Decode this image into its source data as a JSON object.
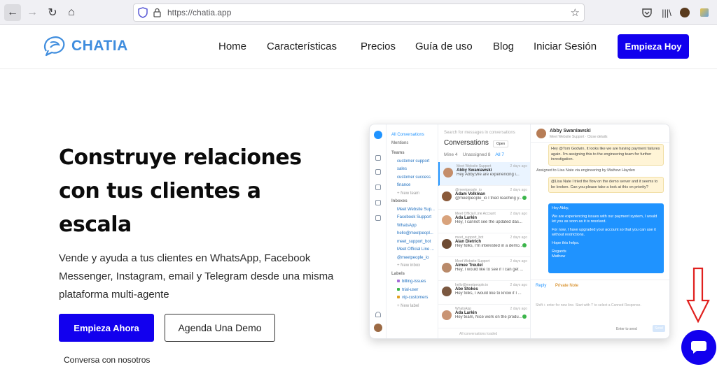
{
  "browser": {
    "url": "https://chatia.app",
    "icons": [
      "back-icon",
      "forward-icon",
      "reload-icon",
      "home-icon",
      "shield-icon",
      "lock-icon",
      "star-icon",
      "pocket-icon",
      "library-icon",
      "account-icon",
      "extension-icon"
    ]
  },
  "nav": {
    "logo_text": "CHATIA",
    "items": [
      "Home",
      "Características",
      "Precios",
      "Guía de uso",
      "Blog",
      "Iniciar Sesión"
    ],
    "cta": "Empieza Hoy"
  },
  "hero": {
    "title_lines": [
      "Construye relaciones",
      "con tus clientes a",
      "escala"
    ],
    "subtitle_lines": [
      "Vende y ayuda a tus clientes en WhatsApp, Facebook",
      "Messenger, Instagram, email y Telegram desde una misma",
      "plataforma multi-agente"
    ],
    "primary_button": "Empieza Ahora",
    "secondary_button": "Agenda Una Demo",
    "talk_link": "Conversa con nosotros"
  },
  "mockup": {
    "sidebar": {
      "all": "All Conversations",
      "mentions": "Mentions",
      "teams_header": "Teams",
      "teams": [
        "customer support",
        "sales",
        "customer success",
        "finance"
      ],
      "new_team": "+ New team",
      "inboxes_header": "Inboxes",
      "inboxes": [
        "Meet Website Sup...",
        "Facebook Support",
        "WhatsApp",
        "hello@meetpeopl...",
        "meet_support_bot",
        "Meet Official Line ...",
        "@meetpeople_io"
      ],
      "new_inbox": "+ New inbox",
      "labels_header": "Labels",
      "labels": [
        {
          "name": "billing-issues",
          "color": "#a46bd8"
        },
        {
          "name": "trial-user",
          "color": "#3bb54a"
        },
        {
          "name": "vip-customers",
          "color": "#e0a020"
        }
      ],
      "new_label": "+ New label"
    },
    "list": {
      "search_placeholder": "Search for messages in conversations",
      "title": "Conversations",
      "status": "Open",
      "tabs": [
        "Mine 4",
        "Unassigned 8",
        "All 7"
      ],
      "items": [
        {
          "source": "Meet Website Support",
          "name": "Abby Swaniawski",
          "msg": "Hey Abby,We are experiencing i...",
          "time": "2 days ago",
          "unread": false
        },
        {
          "source": "@meetpeople_io",
          "name": "Adam Volkman",
          "msg": "@meetpeople_io I tried reaching y...",
          "time": "2 days ago",
          "unread": true
        },
        {
          "source": "Meet Official Line Account",
          "name": "Ada Larkin",
          "msg": "Hey, I cannot see the updated das...",
          "time": "2 days ago",
          "unread": false
        },
        {
          "source": "meet_support_bot",
          "name": "Alan Dietrich",
          "msg": "Hey folks, I'm interested in a demo...",
          "time": "2 days ago",
          "unread": true
        },
        {
          "source": "Meet Website Support",
          "name": "Aimee Treutel",
          "msg": "Hey, I would like to see if I can get ...",
          "time": "2 days ago",
          "unread": false
        },
        {
          "source": "hello@meetpeople.io",
          "name": "Abe Stokes",
          "msg": "Hey folks, I would like to know if I ...",
          "time": "2 days ago",
          "unread": false
        },
        {
          "source": "WhatsApp",
          "name": "Ada Larkin",
          "msg": "Hey team, Nice work on the produ...",
          "time": "2 days ago",
          "unread": true
        }
      ],
      "footer": "All conversations loaded"
    },
    "chat": {
      "name": "Abby Swaniawski",
      "sub": "Meet Website Support · Close details",
      "note1": "Hey @Tom Godwin, It looks like we are having payment failures again. I'm assigning this to the engineering team for further investigation.",
      "system": "Assigned to Lisa Nate via engineering by Mathew Hayden",
      "note2": "@Lisa Nate I tried the flow on the demo server and it seems to be broken. Can you please take a look at this on priority?",
      "message_lines": [
        "Hey Abby,",
        "We are experiencing issues with our payment system, I would let you as soon as it is resolved.",
        "For now, I have upgraded your account so that you can use it without restrictions.",
        "Hope this helps.",
        "Regards",
        "Mathew"
      ],
      "reply_tab": "Reply",
      "private_tab": "Private Note",
      "placeholder": "Shift + enter for new line. Start with '/' to select a Canned Response.",
      "enter_to_send": "Enter to send",
      "send": "Send"
    }
  },
  "colors": {
    "brand": "#1200ee",
    "logo": "#3f8dde",
    "accent": "#1f93ff",
    "arrow": "#e0201e"
  }
}
